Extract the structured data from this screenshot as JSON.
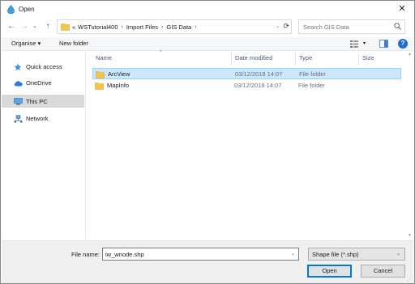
{
  "window": {
    "title": "Open",
    "close_glyph": "✕"
  },
  "nav_buttons": {
    "back": "←",
    "forward": "→",
    "dropdown": "⌄",
    "up": "↑"
  },
  "address": {
    "overflow": "«",
    "crumbs": [
      "WSTutorial400",
      "Import Files",
      "GIS Data"
    ],
    "separator": "›",
    "dropdown": "⌄",
    "refresh": "⟳"
  },
  "search": {
    "placeholder": "Search GIS Data"
  },
  "toolbar": {
    "organise_label": "Organise ▾",
    "new_folder_label": "New folder",
    "view_dropdown": "▾",
    "help_glyph": "?"
  },
  "nav_pane": {
    "items": [
      {
        "label": "Quick access",
        "icon": "star-icon"
      },
      {
        "label": "OneDrive",
        "icon": "cloud-icon"
      },
      {
        "label": "This PC",
        "icon": "computer-icon",
        "selected": true
      },
      {
        "label": "Network",
        "icon": "network-icon"
      }
    ]
  },
  "file_list": {
    "sort_indicator": "^",
    "columns": [
      "Name",
      "Date modified",
      "Type",
      "Size"
    ],
    "rows": [
      {
        "name": "ArcView",
        "date": "03/12/2018 14:07",
        "type": "File folder",
        "size": "",
        "selected": true
      },
      {
        "name": "MapInfo",
        "date": "03/12/2018 14:07",
        "type": "File folder",
        "size": "",
        "selected": false
      }
    ]
  },
  "bottom": {
    "file_name_label": "File name:",
    "file_name_value": "iw_wnode.shp",
    "file_type_value": "Shape file (*.shp)",
    "dropdown": "⌄",
    "open_label": "Open",
    "cancel_label": "Cancel"
  },
  "colors": {
    "selection_bg": "#cce8ff",
    "selection_border": "#99d1ff",
    "accent": "#0078d7",
    "folder": "#f4c54a",
    "help_blue": "#1f6fd1"
  }
}
